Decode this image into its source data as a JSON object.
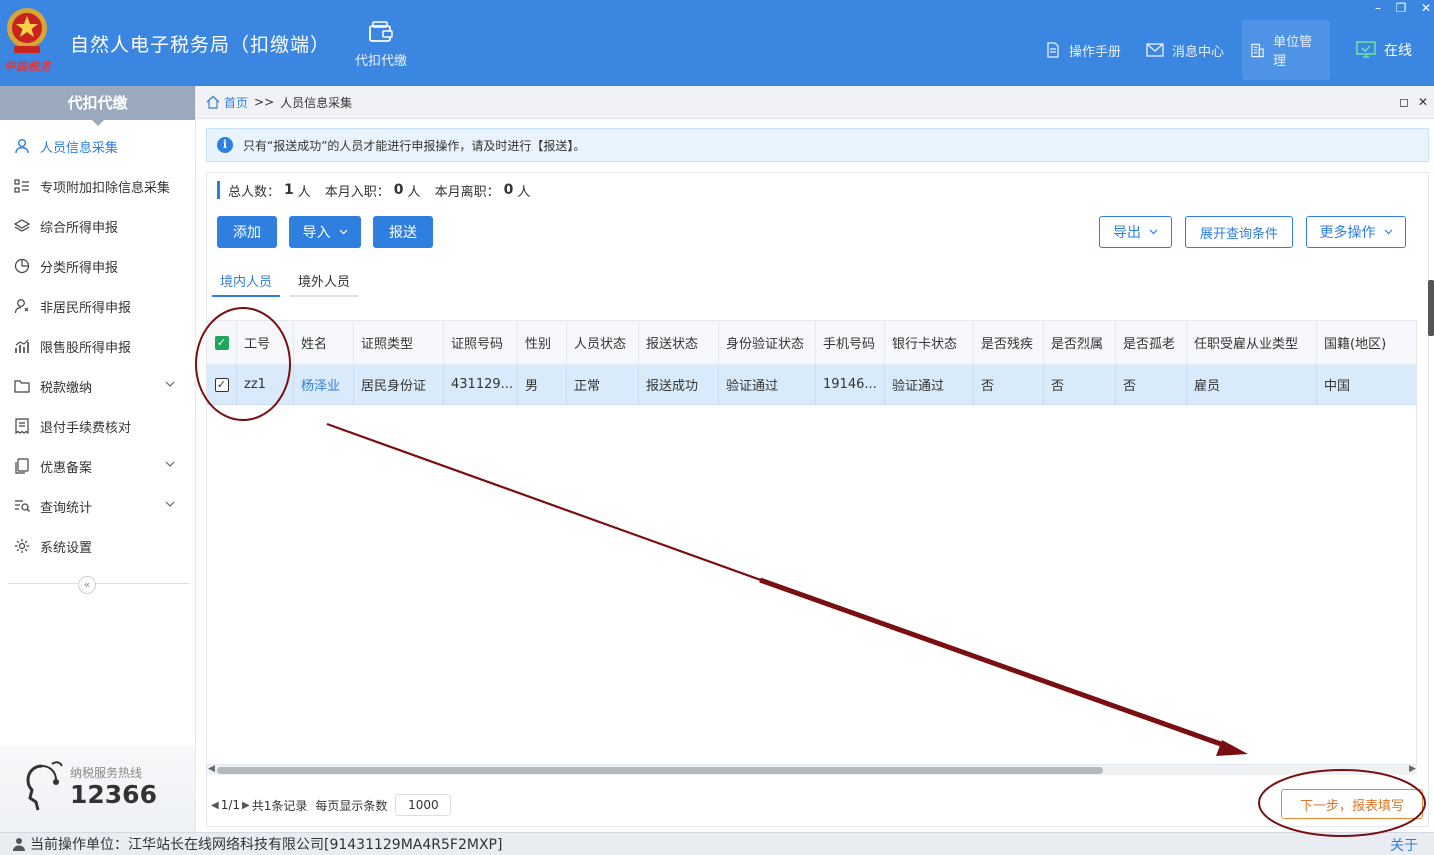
{
  "header": {
    "app_title": "自然人电子税务局（扣缴端）",
    "logo_text": "中国税务",
    "module_label": "代扣代缴",
    "buttons": {
      "manual": "操作手册",
      "messages": "消息中心",
      "unit": "单位管理",
      "online": "在线"
    },
    "window_controls": {
      "minimize": "–",
      "restore": "❐",
      "close": "✕"
    },
    "accent": "#3b86e0"
  },
  "sidebar": {
    "heading": "代扣代缴",
    "items": [
      {
        "label": "人员信息采集",
        "icon": "person-icon"
      },
      {
        "label": "专项附加扣除信息采集",
        "icon": "list-icon"
      },
      {
        "label": "综合所得申报",
        "icon": "layers-icon"
      },
      {
        "label": "分类所得申报",
        "icon": "pie-icon"
      },
      {
        "label": "非居民所得申报",
        "icon": "person-outline-icon"
      },
      {
        "label": "限售股所得申报",
        "icon": "bar-chart-icon"
      },
      {
        "label": "税款缴纳",
        "icon": "folder-icon"
      },
      {
        "label": "退付手续费核对",
        "icon": "receipt-icon"
      },
      {
        "label": "优惠备案",
        "icon": "copy-icon"
      },
      {
        "label": "查询统计",
        "icon": "search-list-icon"
      },
      {
        "label": "系统设置",
        "icon": "gear-icon"
      }
    ],
    "collapse_glyph": "«",
    "hotline_label": "纳税服务热线",
    "hotline_number": "12366"
  },
  "breadcrumb": {
    "home": "首页",
    "separator": ">>",
    "current": "人员信息采集",
    "controls": {
      "max": "◻",
      "close": "✕"
    }
  },
  "notice": {
    "icon_glyph": "i",
    "text": "只有“报送成功”的人员才能进行申报操作，请及时进行【报送】。"
  },
  "stats": {
    "total_label": "总人数：",
    "total": "1",
    "unit": "人",
    "joined_label": "本月入职：",
    "joined": "0",
    "left_label": "本月离职：",
    "left": "0"
  },
  "toolbar": {
    "add": "添加",
    "import": "导入",
    "submit": "报送",
    "export": "导出",
    "expand_query": "展开查询条件",
    "more": "更多操作"
  },
  "tabs": [
    "境内人员",
    "境外人员"
  ],
  "table": {
    "columns": [
      "工号",
      "姓名",
      "证照类型",
      "证照号码",
      "性别",
      "人员状态",
      "报送状态",
      "身份验证状态",
      "手机号码",
      "银行卡状态",
      "是否残疾",
      "是否烈属",
      "是否孤老",
      "任职受雇从业类型",
      "国籍(地区)"
    ],
    "rows": [
      [
        "zz1",
        "杨泽业",
        "居民身份证",
        "431129...",
        "男",
        "正常",
        "报送成功",
        "验证通过",
        "19146...",
        "验证通过",
        "否",
        "否",
        "否",
        "雇员",
        "中国"
      ]
    ],
    "row_checked": true,
    "header_checked": true
  },
  "pager": {
    "page": "1/1",
    "total_records": "共1条记录",
    "page_size_label": "每页显示条数",
    "page_size": "1000"
  },
  "next_step": "下一步，报表填写",
  "status_bar": {
    "current_unit": "当前操作单位：江华站长在线网络科技有限公司[91431129MA4R5F2MXP]",
    "close_link": "关于"
  },
  "annotation_color": "#7a0f12"
}
